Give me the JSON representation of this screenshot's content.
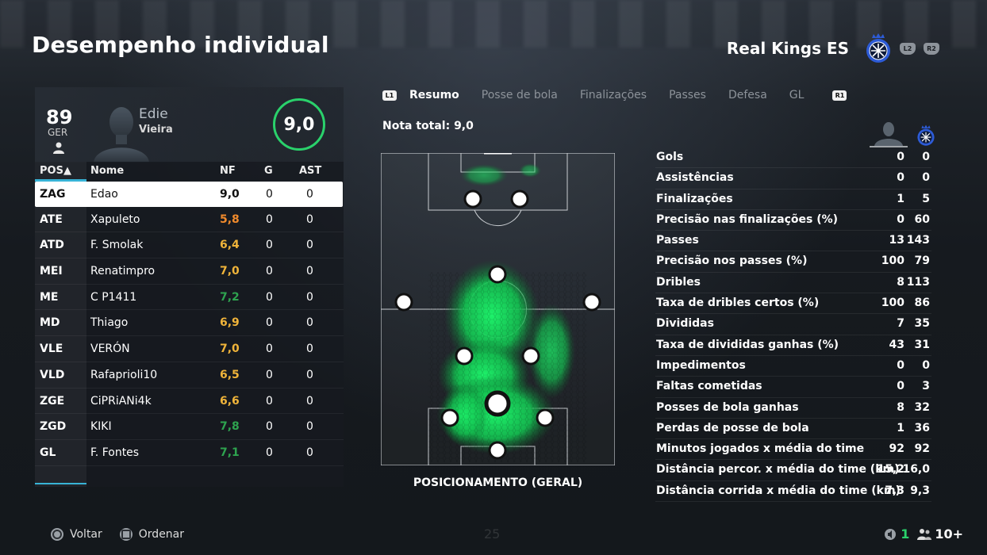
{
  "page_title": "Desempenho individual",
  "team": {
    "name": "Real Kings ES",
    "l2_label": "L2",
    "r2_label": "R2"
  },
  "player": {
    "overall": "89",
    "position": "GER",
    "first_name": "Edie",
    "last_name": "Vieira",
    "rating": "9,0"
  },
  "table": {
    "headers": {
      "pos": "POS▲",
      "name": "Nome",
      "nf": "NF",
      "g": "G",
      "ast": "AST"
    },
    "rows": [
      {
        "pos": "ZAG",
        "name": "Edao",
        "nf": "9,0",
        "nf_color": "#111111",
        "g": "0",
        "ast": "0"
      },
      {
        "pos": "ATE",
        "name": "Xapuleto",
        "nf": "5,8",
        "nf_color": "#f08a2c",
        "g": "0",
        "ast": "0"
      },
      {
        "pos": "ATD",
        "name": "F. Smolak",
        "nf": "6,4",
        "nf_color": "#f0b43a",
        "g": "0",
        "ast": "0"
      },
      {
        "pos": "MEI",
        "name": "Renatimpro",
        "nf": "7,0",
        "nf_color": "#f0b43a",
        "g": "0",
        "ast": "0"
      },
      {
        "pos": "ME",
        "name": "C P1411",
        "nf": "7,2",
        "nf_color": "#2ea34f",
        "g": "0",
        "ast": "0"
      },
      {
        "pos": "MD",
        "name": "Thiago",
        "nf": "6,9",
        "nf_color": "#f0b43a",
        "g": "0",
        "ast": "0"
      },
      {
        "pos": "VLE",
        "name": "VERÓN",
        "nf": "7,0",
        "nf_color": "#f0b43a",
        "g": "0",
        "ast": "0"
      },
      {
        "pos": "VLD",
        "name": "Rafaprioli10",
        "nf": "6,5",
        "nf_color": "#f0b43a",
        "g": "0",
        "ast": "0"
      },
      {
        "pos": "ZGE",
        "name": "CiPRiANi4k",
        "nf": "6,6",
        "nf_color": "#f0b43a",
        "g": "0",
        "ast": "0"
      },
      {
        "pos": "ZGD",
        "name": "KIKI",
        "nf": "7,8",
        "nf_color": "#2ea34f",
        "g": "0",
        "ast": "0"
      },
      {
        "pos": "GL",
        "name": "F. Fontes",
        "nf": "7,1",
        "nf_color": "#2ea34f",
        "g": "0",
        "ast": "0"
      }
    ]
  },
  "tabs": {
    "l1_label": "L1",
    "r1_label": "R1",
    "items": [
      "Resumo",
      "Posse de bola",
      "Finalizações",
      "Passes",
      "Defesa",
      "GL"
    ],
    "active_index": 0
  },
  "total_label": "Nota total: 9,0",
  "pitch_caption": "POSICIONAMENTO (GERAL)",
  "stats": [
    {
      "label": "Gols",
      "player": "0",
      "team": "0"
    },
    {
      "label": "Assistências",
      "player": "0",
      "team": "0"
    },
    {
      "label": "Finalizações",
      "player": "1",
      "team": "5"
    },
    {
      "label": "Precisão nas finalizações (%)",
      "player": "0",
      "team": "60"
    },
    {
      "label": "Passes",
      "player": "13",
      "team": "143"
    },
    {
      "label": "Precisão nos passes (%)",
      "player": "100",
      "team": "79"
    },
    {
      "label": "Dribles",
      "player": "8",
      "team": "113"
    },
    {
      "label": "Taxa de dribles certos (%)",
      "player": "100",
      "team": "86"
    },
    {
      "label": "Divididas",
      "player": "7",
      "team": "35"
    },
    {
      "label": "Taxa de divididas ganhas (%)",
      "player": "43",
      "team": "31"
    },
    {
      "label": "Impedimentos",
      "player": "0",
      "team": "0"
    },
    {
      "label": "Faltas cometidas",
      "player": "0",
      "team": "3"
    },
    {
      "label": "Posses de bola ganhas",
      "player": "8",
      "team": "32"
    },
    {
      "label": "Perdas de posse de bola",
      "player": "1",
      "team": "36"
    },
    {
      "label": "Minutos jogados x média do time",
      "player": "92",
      "team": "92"
    },
    {
      "label": "Distância percor. x média do time (km)",
      "player": "15,2",
      "team": "16,0"
    },
    {
      "label": "Distância corrida x média do time (km)",
      "player": "7,3",
      "team": "9,3"
    }
  ],
  "footer": {
    "back_label": "Voltar",
    "sort_label": "Ordenar",
    "ghost_number": "25",
    "mic_count": "1",
    "players_count": "10+"
  },
  "colors": {
    "accent_blue": "#38b3d6",
    "rating_green": "#2ad16b",
    "heat_green": "#16e85a",
    "crest_blue": "#2d5bd6"
  }
}
